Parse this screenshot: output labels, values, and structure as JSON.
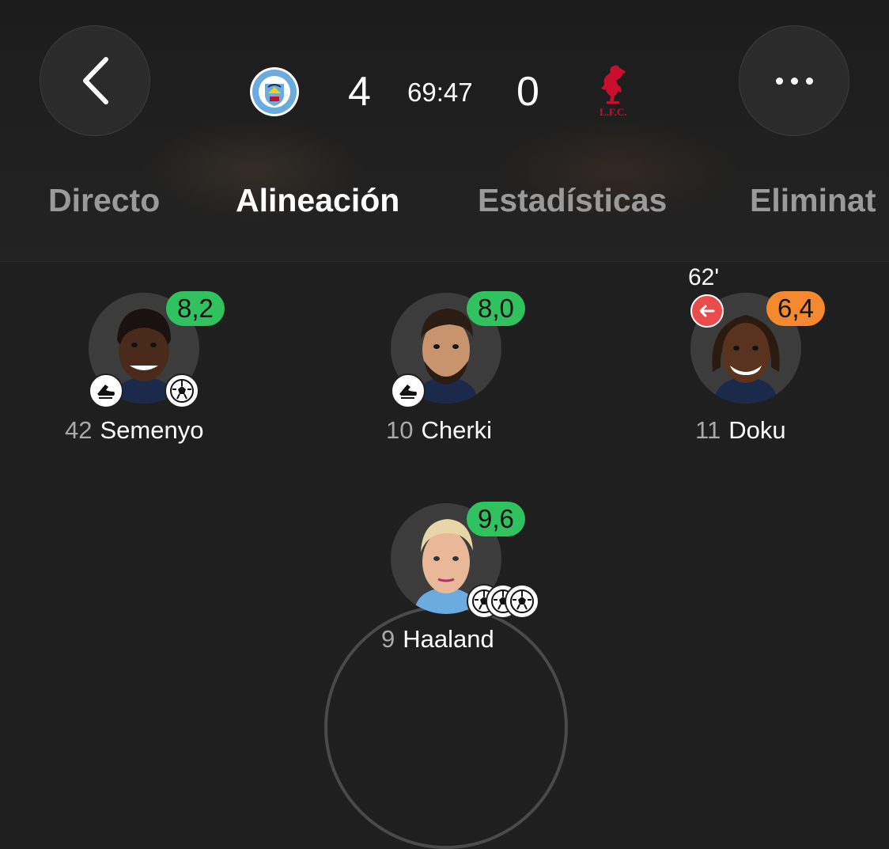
{
  "header": {
    "home_team": "Manchester City",
    "away_team": "Liverpool",
    "home_score": "4",
    "away_score": "0",
    "clock": "69:47",
    "home_crest_text": "MANCHESTER CITY",
    "away_crest_text": "L.F.C."
  },
  "tabs": [
    {
      "label": "Directo"
    },
    {
      "label": "Alineación",
      "active": true
    },
    {
      "label": "Estadísticas"
    },
    {
      "label": "Eliminat"
    }
  ],
  "players": [
    {
      "number": "42",
      "name": "Semenyo",
      "rating": "8,2",
      "rating_color": "#2fc25e",
      "badges": [
        "assist-boot-icon",
        "goal-ball-icon"
      ]
    },
    {
      "number": "10",
      "name": "Cherki",
      "rating": "8,0",
      "rating_color": "#2fc25e",
      "badges": [
        "assist-boot-icon"
      ]
    },
    {
      "number": "11",
      "name": "Doku",
      "rating": "6,4",
      "rating_color": "#f5892f",
      "sub_time": "62'",
      "badges": [
        "sub-out-arrow-icon"
      ]
    },
    {
      "number": "9",
      "name": "Haaland",
      "rating": "9,6",
      "rating_color": "#2fc25e",
      "badges": [
        "goal-ball-icon",
        "goal-ball-icon",
        "goal-ball-icon"
      ]
    }
  ],
  "colors": {
    "background": "#1f1f1f",
    "rating_good": "#2fc25e",
    "rating_mid": "#f5892f",
    "sub_badge": "#ea4b4b",
    "liverpool_red": "#c8102e",
    "city_blue": "#6cabdd"
  }
}
